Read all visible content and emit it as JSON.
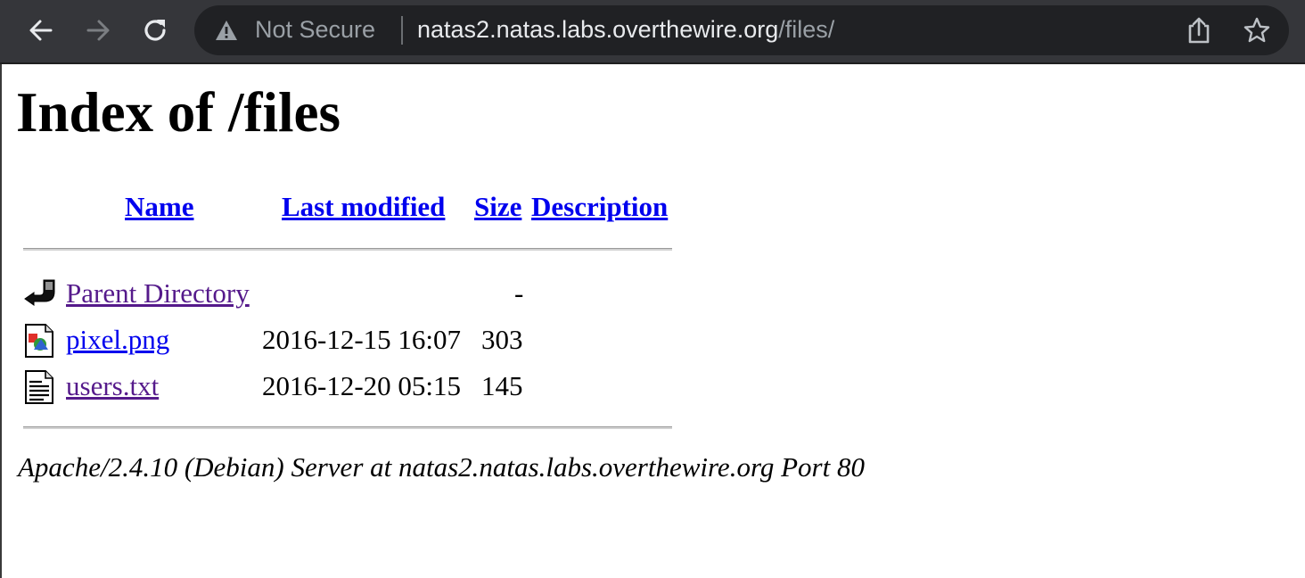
{
  "browser": {
    "security_label": "Not Secure",
    "url_host": "natas2.natas.labs.overthewire.org",
    "url_path": "/files/",
    "icons": {
      "back": "arrow-left-icon",
      "forward": "arrow-right-icon",
      "reload": "reload-icon",
      "warning": "warning-triangle-icon",
      "share": "share-icon",
      "bookmark": "star-icon"
    },
    "colors": {
      "toolbar": "#35363a",
      "omnibox": "#202124",
      "text_primary": "#e8eaed",
      "text_secondary": "#9aa0a6"
    }
  },
  "page": {
    "title": "Index of /files",
    "columns": {
      "name": "Name",
      "last_modified": "Last modified",
      "size": "Size",
      "description": "Description"
    },
    "rows": [
      {
        "name": "Parent Directory",
        "modified": "",
        "size": "-",
        "icon": "parent-directory-icon",
        "visited": true
      },
      {
        "name": "pixel.png",
        "modified": "2016-12-15 16:07",
        "size": "303",
        "icon": "image-file-icon",
        "visited": false
      },
      {
        "name": "users.txt",
        "modified": "2016-12-20 05:15",
        "size": "145",
        "icon": "text-file-icon",
        "visited": true
      }
    ],
    "address": "Apache/2.4.10 (Debian) Server at natas2.natas.labs.overthewire.org Port 80",
    "colors": {
      "link": "#0000ee",
      "visited_link": "#551a8b"
    }
  }
}
